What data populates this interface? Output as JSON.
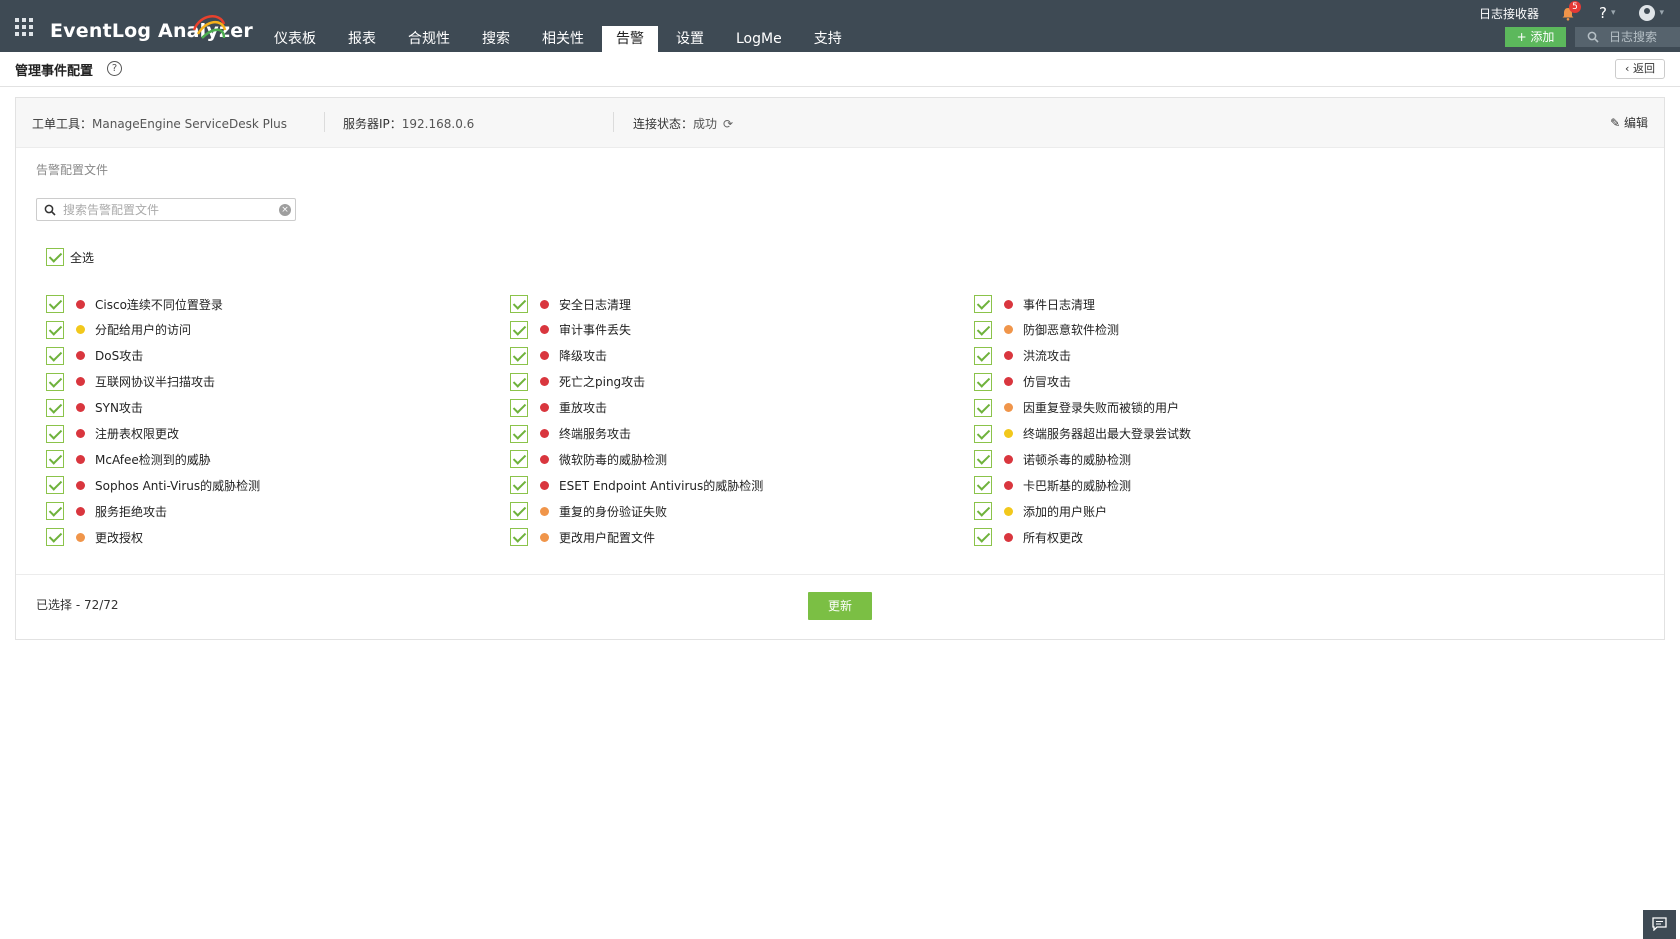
{
  "app": {
    "title": "EventLog Analyzer"
  },
  "nav": {
    "tabs": [
      {
        "label": "仪表板"
      },
      {
        "label": "报表"
      },
      {
        "label": "合规性"
      },
      {
        "label": "搜索"
      },
      {
        "label": "相关性"
      },
      {
        "label": "告警"
      },
      {
        "label": "设置"
      },
      {
        "label": "LogMe"
      },
      {
        "label": "支持"
      }
    ],
    "active": "告警"
  },
  "topbar": {
    "collector_label": "日志接收器",
    "notification_count": "5",
    "help_label": "?",
    "add_label": "+ 添加",
    "log_search_label": "日志搜索"
  },
  "page": {
    "title": "管理事件配置",
    "back_label": "返回"
  },
  "info": {
    "tool_label": "工单工具：",
    "tool_value": "ManageEngine ServiceDesk Plus",
    "ip_label": "服务器IP：",
    "ip_value": "192.168.0.6",
    "status_label": "连接状态：",
    "status_value": "成功",
    "edit_label": "编辑"
  },
  "profiles": {
    "section_label": "告警配置文件",
    "search_placeholder": "搜索告警配置文件",
    "select_all_label": "全选",
    "severity_colors": {
      "red": "#d9363e",
      "orange": "#f0954a",
      "yellow": "#f2c81c"
    },
    "columns": [
      [
        {
          "label": "Cisco连续不同位置登录",
          "severity": "red",
          "checked": true
        },
        {
          "label": "分配给用户的访问",
          "severity": "yellow",
          "checked": true
        },
        {
          "label": "DoS攻击",
          "severity": "red",
          "checked": true
        },
        {
          "label": "互联网协议半扫描攻击",
          "severity": "red",
          "checked": true
        },
        {
          "label": "SYN攻击",
          "severity": "red",
          "checked": true
        },
        {
          "label": "注册表权限更改",
          "severity": "red",
          "checked": true
        },
        {
          "label": "McAfee检测到的威胁",
          "severity": "red",
          "checked": true
        },
        {
          "label": "Sophos Anti-Virus的威胁检测",
          "severity": "red",
          "checked": true
        },
        {
          "label": "服务拒绝攻击",
          "severity": "red",
          "checked": true
        },
        {
          "label": "更改授权",
          "severity": "orange",
          "checked": true
        }
      ],
      [
        {
          "label": "安全日志清理",
          "severity": "red",
          "checked": true
        },
        {
          "label": "审计事件丢失",
          "severity": "red",
          "checked": true
        },
        {
          "label": "降级攻击",
          "severity": "red",
          "checked": true
        },
        {
          "label": "死亡之ping攻击",
          "severity": "red",
          "checked": true
        },
        {
          "label": "重放攻击",
          "severity": "red",
          "checked": true
        },
        {
          "label": "终端服务攻击",
          "severity": "red",
          "checked": true
        },
        {
          "label": "微软防毒的威胁检测",
          "severity": "red",
          "checked": true
        },
        {
          "label": "ESET Endpoint Antivirus的威胁检测",
          "severity": "red",
          "checked": true
        },
        {
          "label": "重复的身份验证失败",
          "severity": "orange",
          "checked": true
        },
        {
          "label": "更改用户配置文件",
          "severity": "orange",
          "checked": true
        }
      ],
      [
        {
          "label": "事件日志清理",
          "severity": "red",
          "checked": true
        },
        {
          "label": "防御恶意软件检测",
          "severity": "orange",
          "checked": true
        },
        {
          "label": "洪流攻击",
          "severity": "red",
          "checked": true
        },
        {
          "label": "仿冒攻击",
          "severity": "red",
          "checked": true
        },
        {
          "label": "因重复登录失败而被锁的用户",
          "severity": "orange",
          "checked": true
        },
        {
          "label": "终端服务器超出最大登录尝试数",
          "severity": "yellow",
          "checked": true
        },
        {
          "label": "诺顿杀毒的威胁检测",
          "severity": "red",
          "checked": true
        },
        {
          "label": "卡巴斯基的威胁检测",
          "severity": "red",
          "checked": true
        },
        {
          "label": "添加的用户账户",
          "severity": "yellow",
          "checked": true
        },
        {
          "label": "所有权更改",
          "severity": "red",
          "checked": true
        }
      ]
    ],
    "selected_label": "已选择 - 72/72",
    "update_label": "更新"
  }
}
